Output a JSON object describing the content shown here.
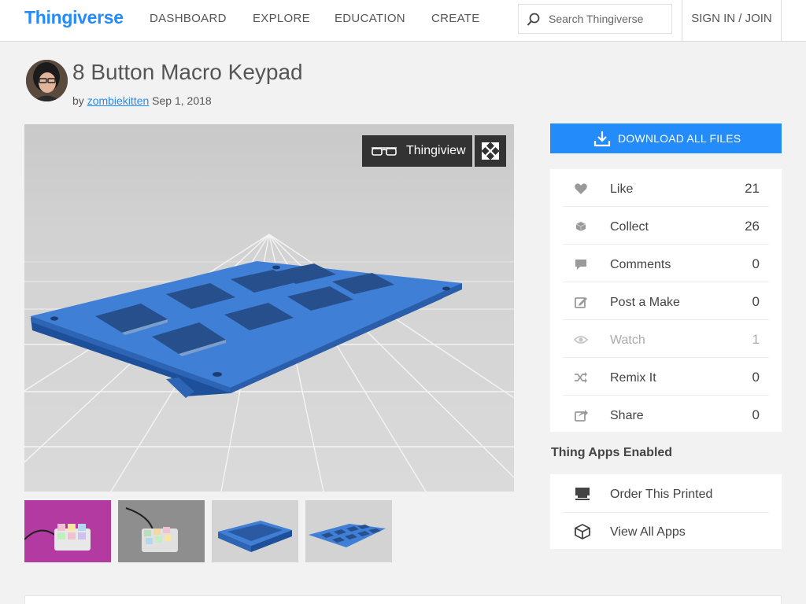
{
  "header": {
    "logo": "Thingiverse",
    "nav": [
      "DASHBOARD",
      "EXPLORE",
      "EDUCATION",
      "CREATE"
    ],
    "search_placeholder": "Search Thingiverse",
    "signin": "SIGN IN / JOIN"
  },
  "thing": {
    "title": "8 Button Macro Keypad",
    "by": "by",
    "author": "zombiekitten",
    "date": "Sep 1, 2018"
  },
  "viewer": {
    "thingview_label": "Thingiview",
    "model_color": "#3f7fd6"
  },
  "thumbnails": [
    "keypad-photo-pink",
    "keypad-photo-gray",
    "model-case",
    "model-plate"
  ],
  "actions": {
    "download_label": "DOWNLOAD ALL FILES",
    "stats": [
      {
        "label": "Like",
        "count": "21",
        "icon": "heart-icon"
      },
      {
        "label": "Collect",
        "count": "26",
        "icon": "collect-icon"
      },
      {
        "label": "Comments",
        "count": "0",
        "icon": "comment-icon"
      },
      {
        "label": "Post a Make",
        "count": "0",
        "icon": "edit-icon"
      },
      {
        "label": "Watch",
        "count": "1",
        "icon": "eye-icon"
      },
      {
        "label": "Remix It",
        "count": "0",
        "icon": "shuffle-icon"
      },
      {
        "label": "Share",
        "count": "0",
        "icon": "share-icon"
      }
    ]
  },
  "apps": {
    "heading": "Thing Apps Enabled",
    "items": [
      {
        "label": "Order This Printed",
        "icon": "printer-icon"
      },
      {
        "label": "View All Apps",
        "icon": "cube-icon"
      }
    ]
  },
  "colors": {
    "accent": "#248bfb",
    "header_bg": "#ffffff",
    "page_bg": "#f2f2f2"
  }
}
